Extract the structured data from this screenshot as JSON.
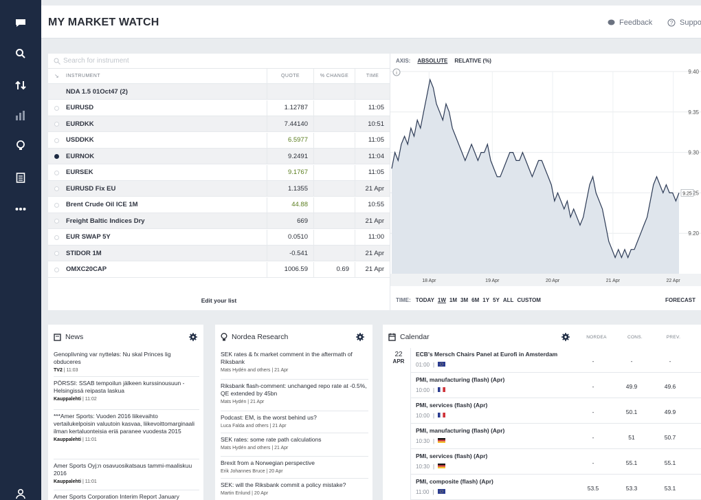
{
  "header": {
    "title": "MY MARKET WATCH",
    "feedback": "Feedback",
    "support": "Suppo"
  },
  "search": {
    "placeholder": "Search for instrument"
  },
  "table": {
    "headers": {
      "instrument": "INSTRUMENT",
      "quote": "QUOTE",
      "change": "% CHANGE",
      "time": "TIME"
    },
    "rows": [
      {
        "name": "NDA 1.5 01Oct47 (2)",
        "quote": "",
        "change": "",
        "time": ""
      },
      {
        "name": "EURUSD",
        "quote": "1.12787",
        "change": "",
        "time": "11:05"
      },
      {
        "name": "EURDKK",
        "quote": "7.44140",
        "change": "",
        "time": "10:51"
      },
      {
        "name": "USDDKK",
        "quote": "6.5977",
        "change": "",
        "time": "11:05"
      },
      {
        "name": "EURNOK",
        "quote": "9.2491",
        "change": "",
        "time": "11:04"
      },
      {
        "name": "EURSEK",
        "quote": "9.1767",
        "change": "",
        "time": "11:05"
      },
      {
        "name": "EURUSD Fix EU",
        "quote": "1.1355",
        "change": "",
        "time": "21 Apr"
      },
      {
        "name": "Brent Crude Oil ICE 1M",
        "quote": "44.88",
        "change": "",
        "time": "10:55"
      },
      {
        "name": "Freight Baltic Indices Dry",
        "quote": "669",
        "change": "",
        "time": "21 Apr"
      },
      {
        "name": "EUR SWAP 5Y",
        "quote": "0.0510",
        "change": "",
        "time": "11:00"
      },
      {
        "name": "STIDOR 1M",
        "quote": "-0.541",
        "change": "",
        "time": "21 Apr"
      },
      {
        "name": "OMXC20CAP",
        "quote": "1006.59",
        "change": "0.69",
        "time": "21 Apr"
      }
    ],
    "edit_label": "Edit your list"
  },
  "chart_controls": {
    "axis_label": "AXIS:",
    "absolute": "ABSOLUTE",
    "relative": "RELATIVE (%)",
    "time_label": "TIME:",
    "ranges": [
      "TODAY",
      "1W",
      "1M",
      "3M",
      "6M",
      "1Y",
      "5Y",
      "ALL",
      "CUSTOM"
    ],
    "active_range": "1W",
    "forecast": "FORECAST"
  },
  "chart_data": {
    "type": "area",
    "x_labels": [
      "18 Apr",
      "19 Apr",
      "20 Apr",
      "21 Apr",
      "22 Apr"
    ],
    "y_ticks": [
      "9.40",
      "9.35",
      "9.30",
      "9.25",
      "9.20"
    ],
    "ylim": [
      9.15,
      9.4
    ],
    "values": [
      9.28,
      9.3,
      9.29,
      9.31,
      9.32,
      9.31,
      9.33,
      9.32,
      9.34,
      9.33,
      9.35,
      9.37,
      9.39,
      9.38,
      9.36,
      9.35,
      9.34,
      9.36,
      9.35,
      9.33,
      9.32,
      9.31,
      9.3,
      9.29,
      9.3,
      9.31,
      9.3,
      9.29,
      9.3,
      9.3,
      9.31,
      9.29,
      9.28,
      9.27,
      9.27,
      9.28,
      9.29,
      9.3,
      9.3,
      9.29,
      9.29,
      9.3,
      9.29,
      9.28,
      9.27,
      9.28,
      9.29,
      9.29,
      9.28,
      9.27,
      9.26,
      9.24,
      9.25,
      9.24,
      9.23,
      9.24,
      9.22,
      9.23,
      9.22,
      9.21,
      9.22,
      9.24,
      9.26,
      9.27,
      9.25,
      9.24,
      9.23,
      9.21,
      9.19,
      9.18,
      9.17,
      9.18,
      9.17,
      9.18,
      9.17,
      9.18,
      9.18,
      9.19,
      9.2,
      9.21,
      9.22,
      9.24,
      9.26,
      9.27,
      9.26,
      9.25,
      9.26,
      9.25,
      9.25,
      9.24,
      9.25
    ],
    "last_label": "9.25"
  },
  "news": {
    "title": "News",
    "items": [
      {
        "text": "Genoplivning var nytteløs: Nu skal Princes lig obduceres",
        "source": "TV2",
        "time": "11:03"
      },
      {
        "text": "PÖRSSI: SSAB tempoilun jälkeen kurssinousuun - Helsingissä reipasta laskua",
        "source": "Kauppalehti",
        "time": "11:02"
      },
      {
        "text": "***Amer Sports: Vuoden 2016 liikevaihto vertailukelpoisin valuutoin kasvaa, liikevoittomarginaali ilman kertaluonteisia eriä paranee vuodesta 2015",
        "source": "Kauppalehti",
        "time": "11:01"
      },
      {
        "text": "Amer Sports Oyj:n osavuosikatsaus tammi-maaliskuu 2016",
        "source": "Kauppalehti",
        "time": "11:01"
      },
      {
        "text": "Amer Sports Corporation Interim Report January",
        "source": "",
        "time": ""
      }
    ]
  },
  "research": {
    "title": "Nordea Research",
    "items": [
      {
        "text": "SEK rates & fx market comment in the aftermath of Riksbank",
        "meta": "Mats Hydén and others",
        "date": "21 Apr"
      },
      {
        "text": "Riksbank flash-comment: unchanged repo rate at -0.5%, QE extended by 45bn",
        "meta": "Mats Hydén",
        "date": "21 Apr"
      },
      {
        "text": "Podcast: EM, is the worst behind us?",
        "meta": "Luca Falda and others",
        "date": "21 Apr"
      },
      {
        "text": "SEK rates: some rate path calculations",
        "meta": "Mats Hydén and others",
        "date": "21 Apr"
      },
      {
        "text": "Brexit from a Norwegian perspective",
        "meta": "Erik Johannes Bruce",
        "date": "20 Apr"
      },
      {
        "text": "SEK: will the Riksbank commit a policy mistake?",
        "meta": "Martin Enlund",
        "date": "20 Apr"
      }
    ]
  },
  "calendar": {
    "title": "Calendar",
    "day": "22",
    "month": "APR",
    "columns": [
      "NORDEA",
      "CONS.",
      "PREV."
    ],
    "events": [
      {
        "title": "ECB's Mersch Chairs Panel at Eurofi in Amsterdam",
        "time": "01:00",
        "flag": "eu",
        "nordea": "-",
        "cons": "-",
        "prev": "-"
      },
      {
        "title": "PMI, manufacturing (flash) (Apr)",
        "time": "10:00",
        "flag": "fr",
        "nordea": "-",
        "cons": "49.9",
        "prev": "49.6"
      },
      {
        "title": "PMI, services (flash) (Apr)",
        "time": "10:00",
        "flag": "fr",
        "nordea": "-",
        "cons": "50.1",
        "prev": "49.9"
      },
      {
        "title": "PMI, manufacturing (flash) (Apr)",
        "time": "10:30",
        "flag": "de",
        "nordea": "-",
        "cons": "51",
        "prev": "50.7"
      },
      {
        "title": "PMI, services (flash) (Apr)",
        "time": "10:30",
        "flag": "de",
        "nordea": "-",
        "cons": "55.1",
        "prev": "55.1"
      },
      {
        "title": "PMI, composite (flash) (Apr)",
        "time": "11:00",
        "flag": "eu",
        "nordea": "53.5",
        "cons": "53.3",
        "prev": "53.1"
      }
    ]
  },
  "colors": {
    "sidebar": "#1d2a42",
    "chart_fill": "#dfe5ec",
    "chart_line": "#2c3a55",
    "accent_green": "#5a7d1e"
  }
}
